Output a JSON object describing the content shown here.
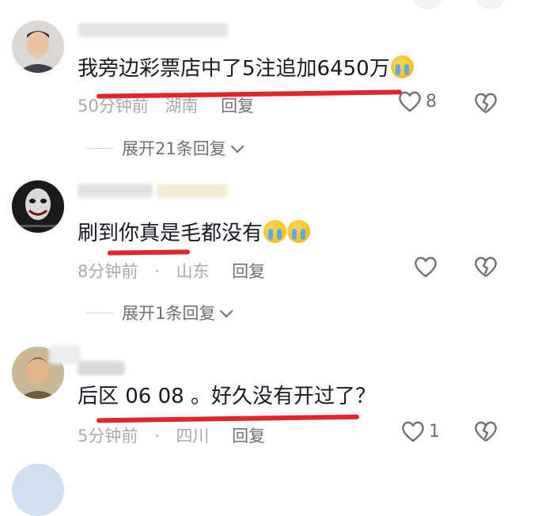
{
  "comments": [
    {
      "text": "我旁边彩票店中了5注追加6450万",
      "emojis": [
        "crying-face"
      ],
      "time": "50分钟前",
      "location": "湖南",
      "reply_label": "回复",
      "like_count": "8",
      "expand_label": "展开21条回复"
    },
    {
      "text": "刷到你真是毛都没有",
      "emojis": [
        "crying-face",
        "crying-face"
      ],
      "time": "8分钟前",
      "separator": "·",
      "location": "山东",
      "reply_label": "回复",
      "like_count": "",
      "expand_label": "展开1条回复"
    },
    {
      "text": "后区 06 08 。好久没有开过了？",
      "emojis": [],
      "time": "5分钟前",
      "separator": "·",
      "location": "四川",
      "reply_label": "回复",
      "like_count": "1"
    }
  ],
  "colors": {
    "underline": "#e0262a",
    "meta_text": "#a8a9ae",
    "reply_text": "#6e6f75",
    "main_text": "#161823"
  }
}
